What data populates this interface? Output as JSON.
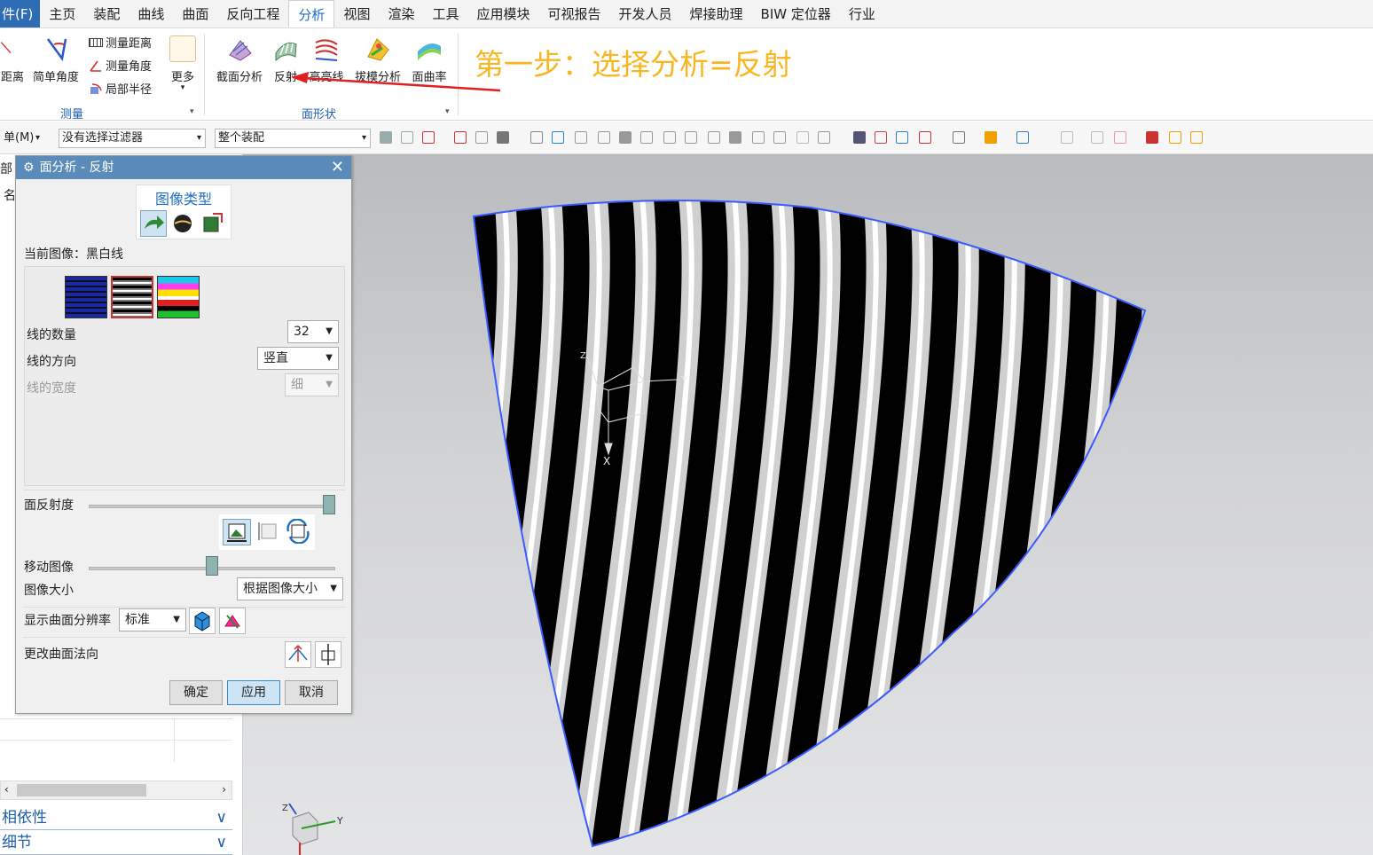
{
  "menu": {
    "file": "件(F)",
    "items": [
      "主页",
      "装配",
      "曲线",
      "曲面",
      "反向工程",
      "分析",
      "视图",
      "渲染",
      "工具",
      "应用模块",
      "可视报告",
      "开发人员",
      "焊接助理",
      "BIW 定位器",
      "行业"
    ],
    "active_index": 5
  },
  "ribbon": {
    "measure": {
      "distance": "距离",
      "simple_angle": "简单角度",
      "measure_distance": "测量距离",
      "measure_angle": "测量角度",
      "local_radius": "局部半径",
      "more": "更多",
      "group_label": "测量"
    },
    "face": {
      "section": "截面分析",
      "reflection": "反射",
      "contour": "高亮线",
      "draft": "拔模分析",
      "curvature": "面曲率",
      "group_label": "面形状"
    },
    "annotation": "第一步：选择分析=反射"
  },
  "toolbar": {
    "menu_label": "单(M)",
    "filter": "没有选择过滤器",
    "scope": "整个装配"
  },
  "left_panel": {
    "header_part": "部",
    "col_name": "名",
    "dependencies": "相依性",
    "details": "细节"
  },
  "dialog": {
    "title": "面分析 - 反射",
    "image_type_label": "图像类型",
    "current_image_label": "当前图像：黑白线",
    "line_count_label": "线的数量",
    "line_count_value": "32",
    "line_direction_label": "线的方向",
    "line_direction_value": "竖直",
    "line_width_label": "线的宽度",
    "line_width_value": "细",
    "reflectivity_label": "面反射度",
    "reflectivity": 1.0,
    "move_image_label": "移动图像",
    "move_image": 0.5,
    "image_size_label": "图像大小",
    "image_size_value": "根据图像大小",
    "resolution_label": "显示曲面分辨率",
    "resolution_value": "标准",
    "change_normal_label": "更改曲面法向",
    "ok": "确定",
    "apply": "应用",
    "cancel": "取消"
  },
  "viewport": {
    "axis_x": "X",
    "axis_y": "Y",
    "axis_z": "Z",
    "surface_edge_color": "#3b5bff"
  },
  "colors": {
    "accent": "#1f6fc0",
    "annotation": "#f7b622",
    "arrow": "#e02020"
  }
}
